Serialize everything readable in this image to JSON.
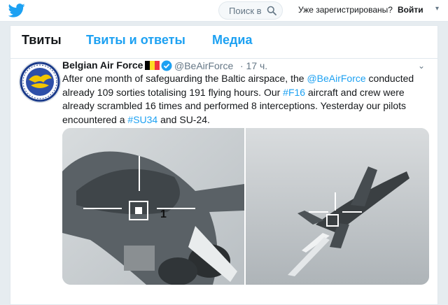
{
  "topbar": {
    "logo_icon": "twitter-bird-icon",
    "search_label": "Поиск в",
    "search_icon": "search-icon",
    "login_question": "Уже зарегистрированы?",
    "login_link": "Войти",
    "login_caret": "▾"
  },
  "tabs": [
    {
      "label": "Твиты"
    },
    {
      "label": "Твиты и ответы"
    },
    {
      "label": "Медиа"
    }
  ],
  "tweet": {
    "author_name": "Belgian Air Force",
    "author_handle": "@BeAirForce",
    "time": "· 17 ч.",
    "caret": "⌄",
    "text_part_1": "After one month of safeguarding the Baltic airspace, the ",
    "mention": "@BeAirForce",
    "text_part_2": " conducted already 109 sorties totalising 191 flying hours. Our ",
    "hashtag_1": "#F16",
    "text_part_3": " aircraft and crew were already scrambled 16 times and performed 8 interceptions. Yesterday our pilots encountered a ",
    "hashtag_2": "#SU34",
    "text_part_4": " and SU-24."
  },
  "colors": {
    "accent": "#1da1f2",
    "text": "#14171a",
    "muted": "#657786",
    "flag": [
      "#000000",
      "#fdda24",
      "#ef3340"
    ]
  }
}
